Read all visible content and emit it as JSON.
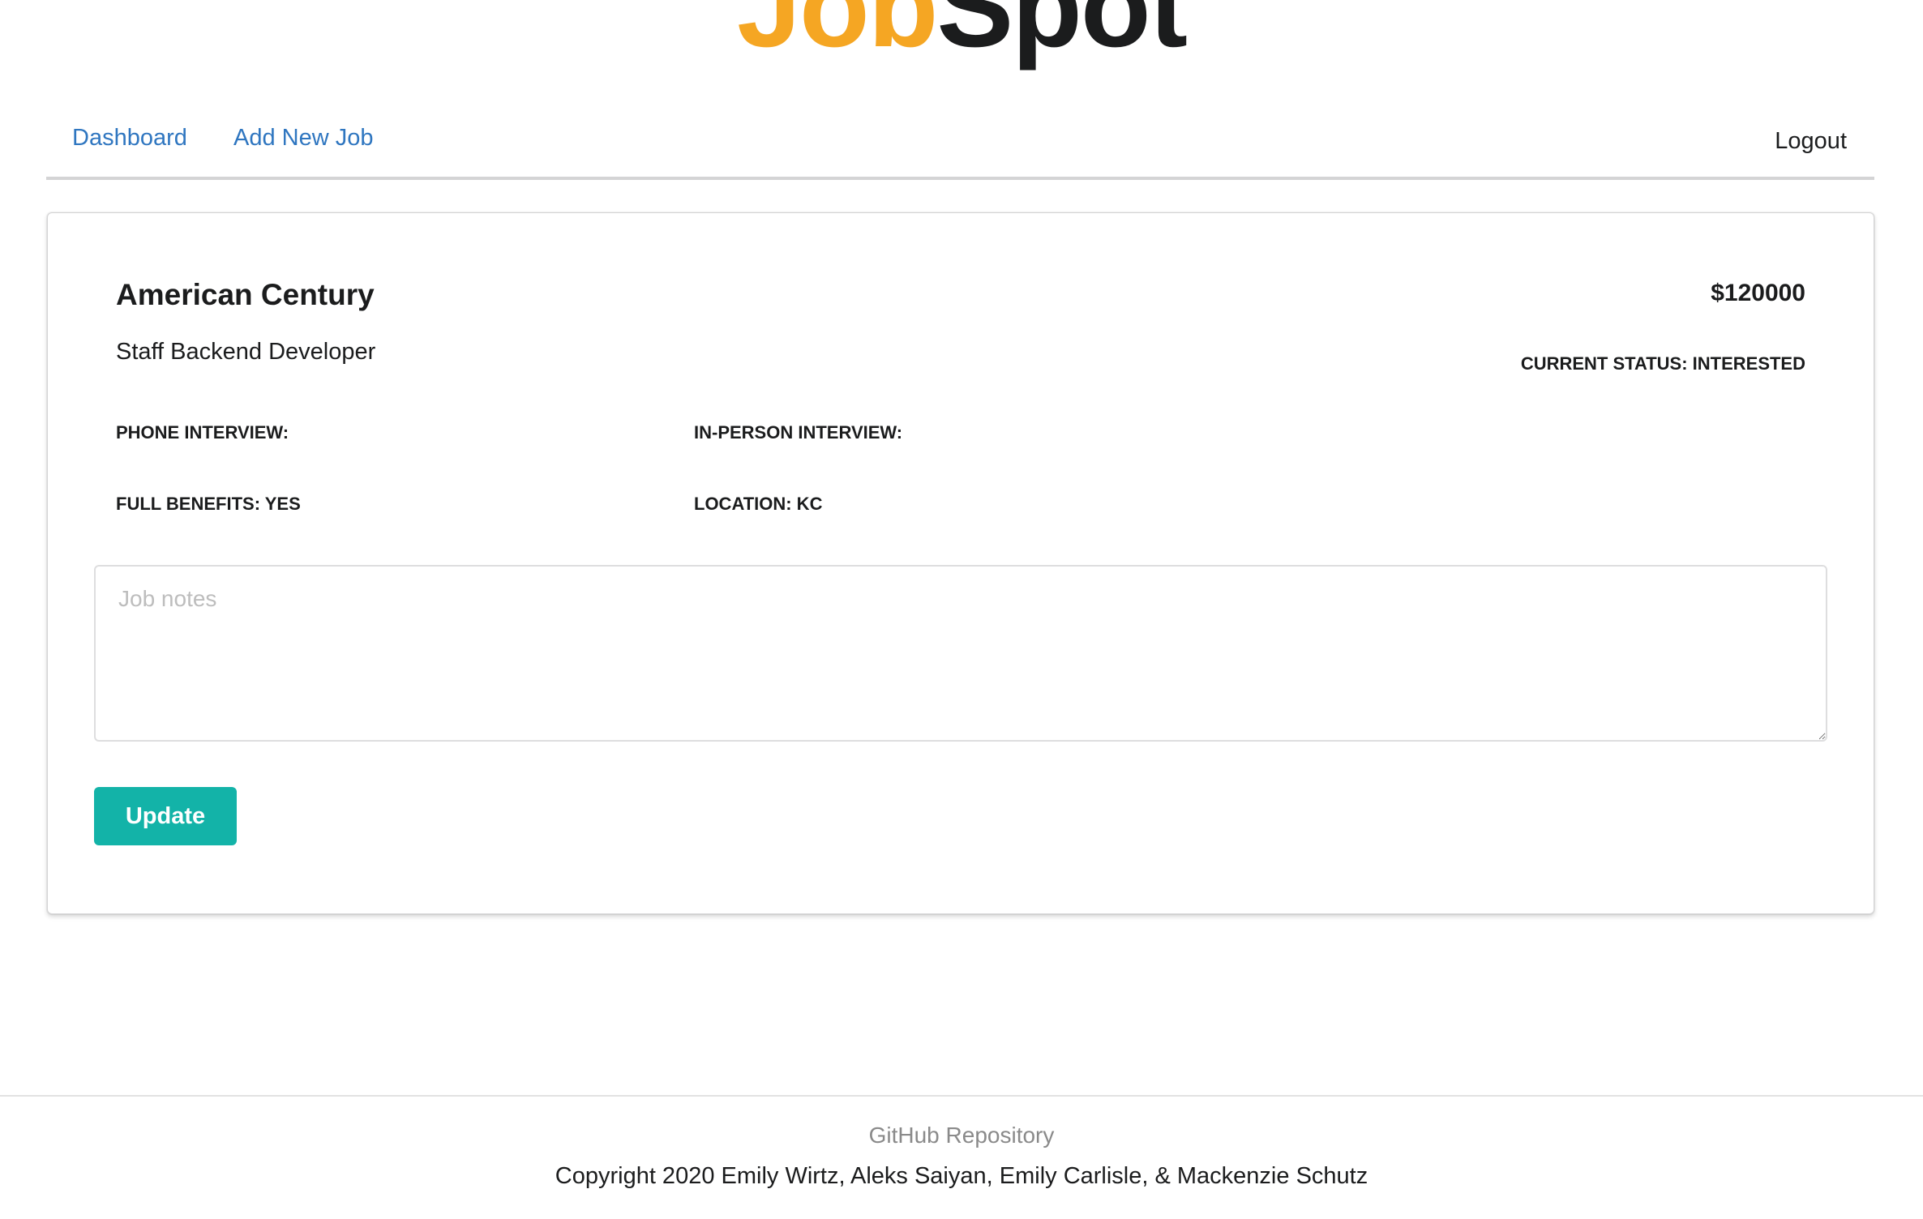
{
  "app": {
    "logo_part1": "Job",
    "logo_part2": "Spot",
    "brand_colors": {
      "accent": "#f5a623",
      "dark": "#1b1c1d",
      "link": "#2f76c0",
      "button": "#13b3a8"
    }
  },
  "nav": {
    "items": [
      {
        "label": "Dashboard"
      },
      {
        "label": "Add New Job"
      }
    ],
    "logout_label": "Logout"
  },
  "job": {
    "company": "American Century",
    "salary": "$120000",
    "title": "Staff Backend Developer",
    "status": "CURRENT STATUS: INTERESTED",
    "phone_interview": "PHONE INTERVIEW:",
    "in_person_interview": "IN-PERSON INTERVIEW:",
    "full_benefits": "FULL BENEFITS: YES",
    "location": "LOCATION: KC",
    "notes_value": "",
    "notes_placeholder": "Job notes",
    "update_label": "Update"
  },
  "footer": {
    "repo_label": "GitHub Repository",
    "copyright": "Copyright 2020 Emily Wirtz, Aleks Saiyan, Emily Carlisle, & Mackenzie Schutz"
  }
}
